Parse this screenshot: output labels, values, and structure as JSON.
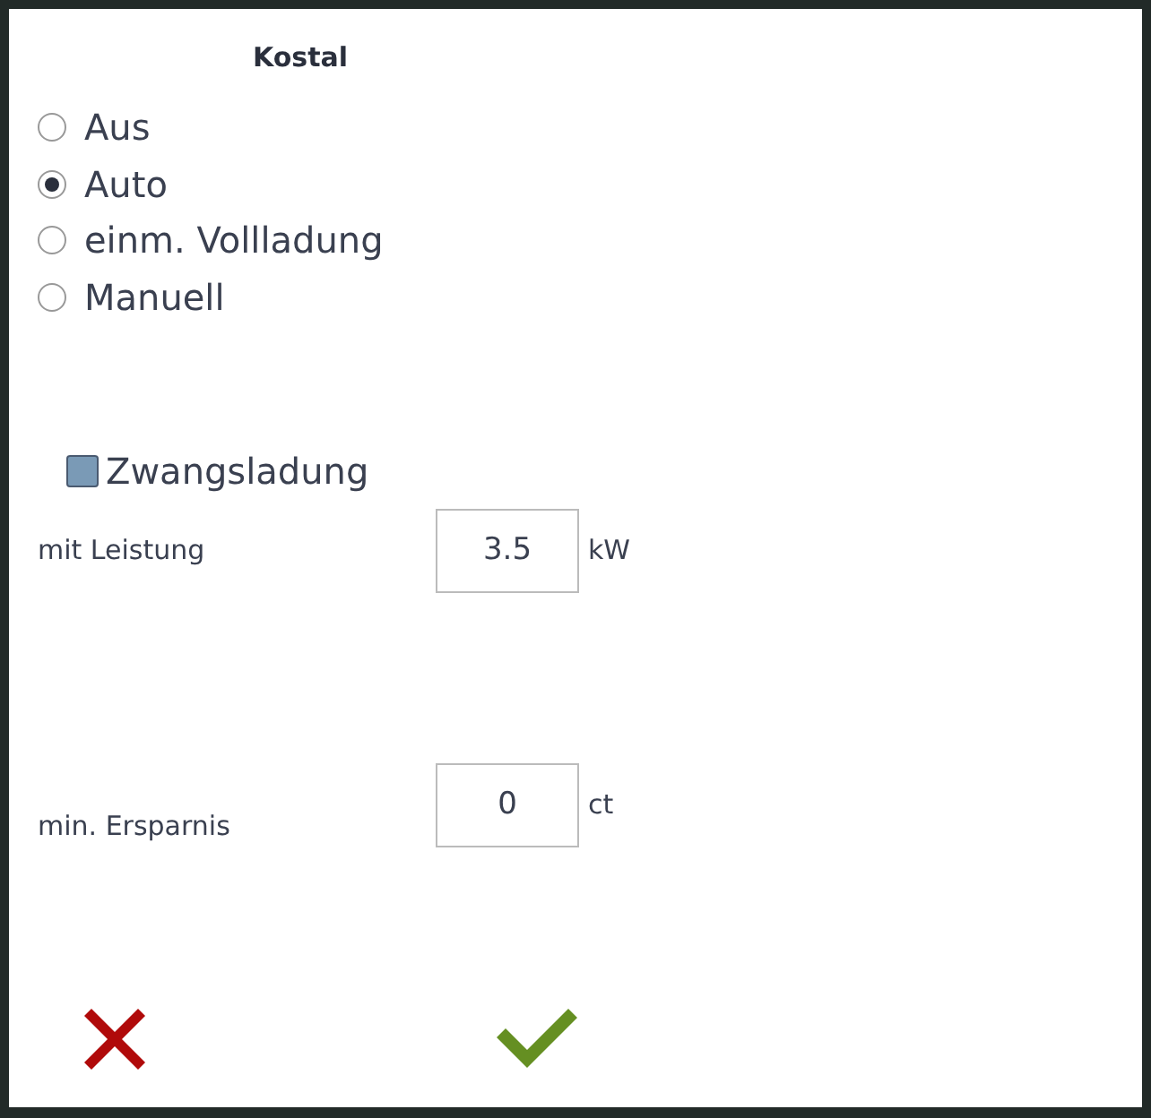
{
  "title": "Kostal",
  "modes": [
    {
      "label": "Aus",
      "selected": false
    },
    {
      "label": "Auto",
      "selected": true
    },
    {
      "label": "einm. Vollladung",
      "selected": false
    },
    {
      "label": "Manuell",
      "selected": false
    }
  ],
  "forced_charge": {
    "label": "Zwangsladung",
    "checked": true
  },
  "fields": [
    {
      "label": "mit Leistung",
      "value": "3.5",
      "unit": "kW"
    },
    {
      "label": "min. Ersparnis",
      "value": "0",
      "unit": "ct"
    }
  ]
}
